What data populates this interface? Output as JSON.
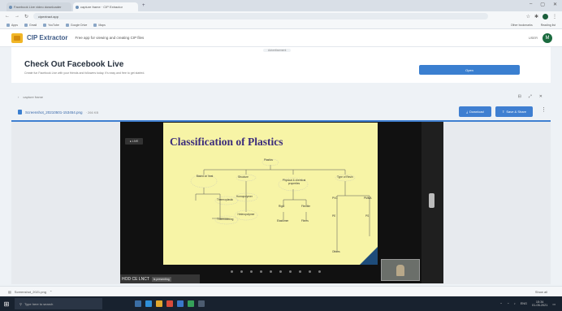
{
  "browser": {
    "tabs": [
      {
        "label": "Facebook Live video downloader",
        "active": false
      },
      {
        "label": "capture frame · CIP Extractor",
        "active": true
      }
    ],
    "url": "cipextract.app",
    "bookmarks": [
      "Apps",
      "Gmail",
      "YouTube",
      "Google Drive",
      "Maps"
    ],
    "bookmarks_right": [
      "Other bookmarks",
      "Reading list"
    ]
  },
  "app": {
    "name": "CIP Extractor",
    "tagline": "Free app for viewing and creating CIP files",
    "header_right": "USER",
    "avatar": "M"
  },
  "banner": {
    "tag": "Advertisement",
    "title": "Check Out Facebook Live",
    "subtitle": "Create fun Facebook Live with your friends and followers today. It's easy and free to get started.",
    "button": "Open"
  },
  "viewer": {
    "crumb": "capture frame",
    "crumb_right": [
      "⊟",
      "⤢",
      "✕"
    ],
    "filename": "Screenshot_20210501-153454.png",
    "fileinfo": "· 266 KB",
    "download_label": "Download",
    "share_label": "Save & Share",
    "live_badge": "● LIVE",
    "slide": {
      "title": "Classification of Plastics",
      "nodes": [
        "Plastics",
        "Based on heat",
        "Structure",
        "Physical & chemical properties",
        "Type of Resin",
        "Thermoplastic",
        "Homopolymer",
        "Rigid",
        "Flexible",
        "Thermosetting",
        "Heteropolymer",
        "Elastomer",
        "Fibres",
        "PVC",
        "PMMA",
        "PE",
        "PS",
        "Others"
      ]
    },
    "caption": "HOD CE LNCT",
    "caption_sub": "is presenting"
  },
  "downloads": {
    "item": "Screenshot_2021.png",
    "show_all": "Show all"
  },
  "taskbar": {
    "search_placeholder": "Type here to search",
    "time": "15:34",
    "date": "01-05-2021",
    "lang": "ENG"
  }
}
